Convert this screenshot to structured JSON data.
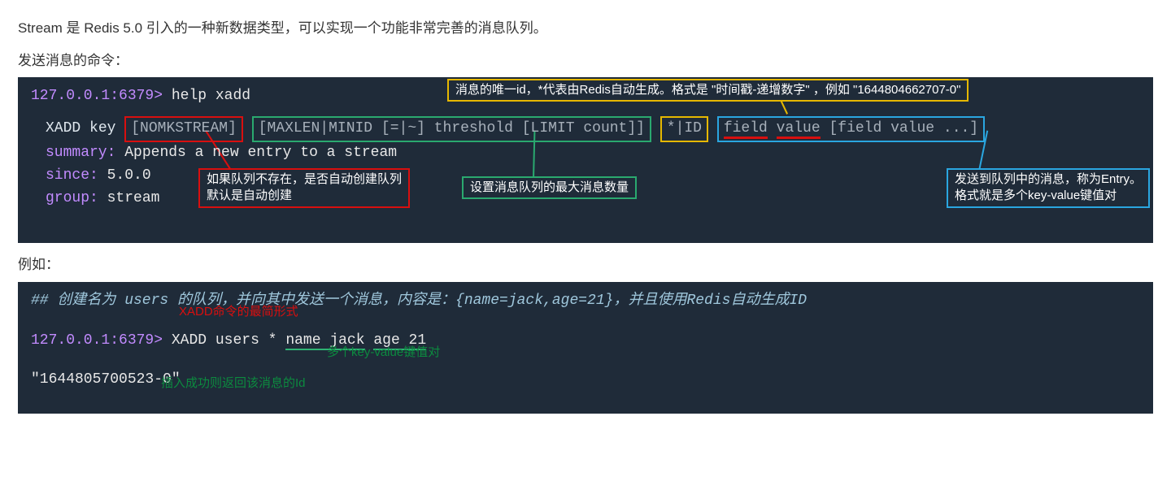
{
  "intro": "Stream 是 Redis 5.0 引入的一种新数据类型，可以实现一个功能非常完善的消息队列。",
  "sendLabel": "发送消息的命令：",
  "example": "例如：",
  "term1": {
    "prompt": "127.0.0.1:6379>",
    "help": "help xadd",
    "cmd": "XADD",
    "key": "key",
    "nomk": "[NOMKSTREAM]",
    "max": "[MAXLEN|MINID [=|~] threshold [LIMIT count]]",
    "id": "*|ID",
    "field": "field",
    "value": "value",
    "more": "[field value ...]",
    "summary_k": "summary:",
    "summary_v": "Appends a new entry to a stream",
    "since_k": "since:",
    "since_v": "5.0.0",
    "group_k": "group:",
    "group_v": "stream",
    "note_yellow": "消息的唯一id，*代表由Redis自动生成。格式是 \"时间戳-递增数字\" ，例如 \"1644804662707-0\"",
    "note_red_l1": "如果队列不存在，是否自动创建队列",
    "note_red_l2": "默认是自动创建",
    "note_green": "设置消息队列的最大消息数量",
    "note_cyan_l1": "发送到队列中的消息，称为Entry。",
    "note_cyan_l2": "格式就是多个key-value键值对"
  },
  "term2": {
    "comment": "## 创建名为 users 的队列，并向其中发送一个消息，内容是：{name=jack,age=21}，并且使用Redis自动生成ID",
    "anno_red": "XADD命令的最简形式",
    "prompt": "127.0.0.1:6379>",
    "cmd": "XADD",
    "args_a": "users *",
    "kv1": "name jack",
    "kv2": "age 21",
    "anno_green_kv": "多个key-value键值对",
    "result": "\"1644805700523-0\"",
    "anno_green_ret": "插入成功则返回该消息的Id"
  }
}
